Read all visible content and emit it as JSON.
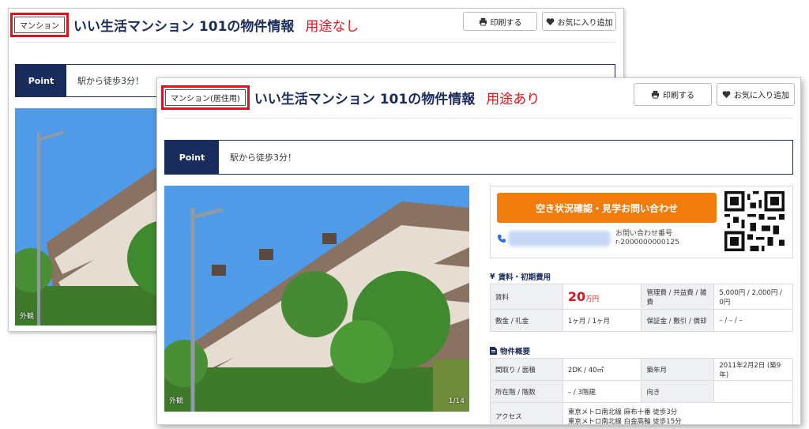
{
  "back": {
    "type_badge": "マンション",
    "title": "いい生活マンション 101の物件情報",
    "annotation": "用途なし",
    "print_label": "印刷する",
    "fav_label": "お気に入り追加",
    "point_label": "Point",
    "point_text": "駅から徒歩3分！",
    "photo_caption": "外観"
  },
  "front": {
    "type_badge": "マンション(居住用)",
    "title": "いい生活マンション 101の物件情報",
    "annotation": "用途あり",
    "print_label": "印刷する",
    "fav_label": "お気に入り追加",
    "point_label": "Point",
    "point_text": "駅から徒歩3分！",
    "photo_caption": "外観",
    "photo_counter": "1/14",
    "contact": {
      "cta_label": "空き状況確認・見学お問い合わせ",
      "inquiry_label": "お問い合わせ番号",
      "inquiry_number": "r-2000000000125"
    },
    "rent_section": {
      "heading": "賃料・初期費用",
      "rent_label": "賃料",
      "rent_value": "20",
      "rent_unit": "万円",
      "mgmt_label": "管理費 / 共益費 / 雑費",
      "mgmt_value": "5,000円 / 2,000円 / 0円",
      "deposit_label": "敷金 / 礼金",
      "deposit_value": "1ヶ月 / 1ヶ月",
      "guarantee_label": "保証金 / 敷引 / 償却",
      "guarantee_value": "– / – / –"
    },
    "overview_section": {
      "heading": "物件概要",
      "layout_label": "間取り / 面積",
      "layout_value": "2DK / 40㎡",
      "built_label": "築年月",
      "built_value": "2011年2月2日 (築9年)",
      "floor_label": "所在階 / 階数",
      "floor_value": "– / 3階建",
      "direction_label": "向き",
      "direction_value": "",
      "access_label": "アクセス",
      "access_line1": "東京メトロ南北線 麻布十番 徒歩3分",
      "access_line2": "東京メトロ南北線 白金高輪 徒歩15分"
    }
  },
  "colors": {
    "navy": "#1a2c5b",
    "highlight_red": "#e0101c",
    "cta_orange": "#f07c0c"
  }
}
